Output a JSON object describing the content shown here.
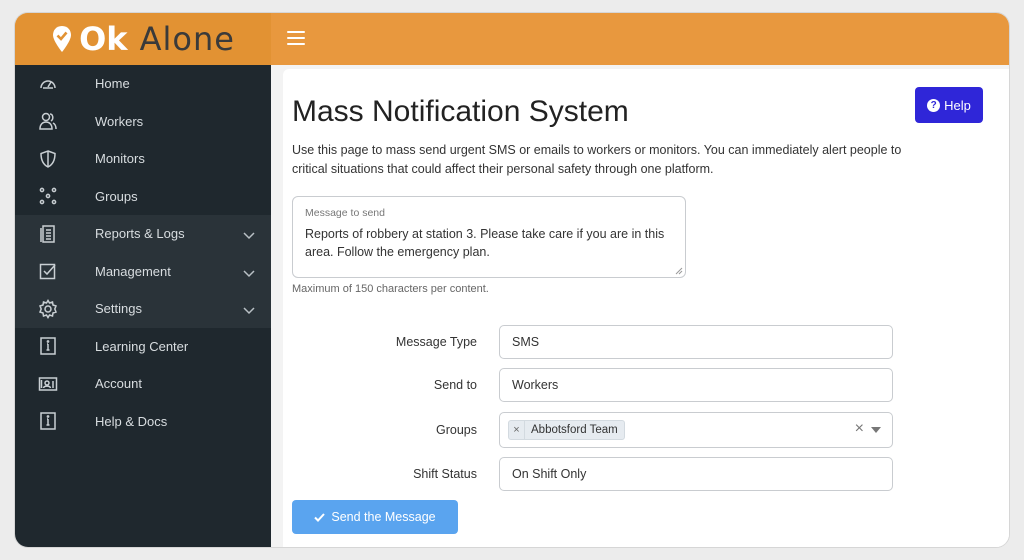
{
  "brand": {
    "name_part1": "Ok",
    "name_part2": "Alone",
    "colors": {
      "topbar": "#e8983e",
      "accent": "#2f26d8"
    }
  },
  "sidebar": {
    "items": [
      {
        "label": "Home",
        "icon": "dashboard-gauge-icon"
      },
      {
        "label": "Workers",
        "icon": "users-icon"
      },
      {
        "label": "Monitors",
        "icon": "shield-icon"
      },
      {
        "label": "Groups",
        "icon": "groups-dots-icon"
      },
      {
        "label": "Reports & Logs",
        "icon": "report-document-icon",
        "expandable": true
      },
      {
        "label": "Management",
        "icon": "checkbox-edit-icon",
        "expandable": true
      },
      {
        "label": "Settings",
        "icon": "gear-icon",
        "expandable": true
      },
      {
        "label": "Learning Center",
        "icon": "info-doc-icon"
      },
      {
        "label": "Account",
        "icon": "account-card-icon"
      },
      {
        "label": "Help & Docs",
        "icon": "info-doc-icon"
      }
    ]
  },
  "page": {
    "title": "Mass Notification System",
    "help_label": "Help",
    "description": "Use this page to mass send urgent SMS or emails to workers or monitors. You can immediately alert people to critical situations that could affect their personal safety through one platform."
  },
  "message": {
    "label": "Message to send",
    "value": "Reports of robbery at station 3. Please take care if you are in this area. Follow the emergency plan.",
    "hint": "Maximum of 150 characters per content."
  },
  "form": {
    "message_type": {
      "label": "Message Type",
      "value": "SMS"
    },
    "send_to": {
      "label": "Send to",
      "value": "Workers"
    },
    "groups": {
      "label": "Groups",
      "tag": "Abbotsford Team",
      "tag_remove": "×",
      "clear": "×"
    },
    "shift_status": {
      "label": "Shift Status",
      "value": "On Shift Only"
    }
  },
  "actions": {
    "send_label": "Send the Message"
  }
}
